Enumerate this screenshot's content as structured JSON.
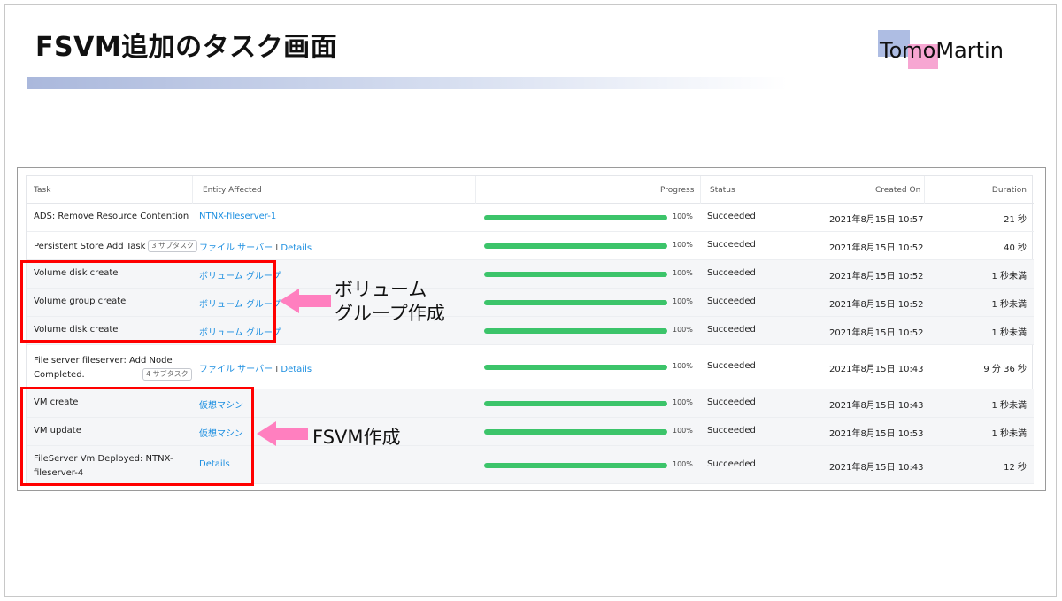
{
  "slide": {
    "title": "FSVM追加のタスク画面",
    "logo_text": "TomoMartin"
  },
  "table": {
    "headers": {
      "task": "Task",
      "entity": "Entity Affected",
      "progress": "Progress",
      "status": "Status",
      "created": "Created On",
      "duration": "Duration"
    },
    "rows": [
      {
        "task": "ADS: Remove Resource Contention",
        "badge": "",
        "entity": "NTNX-fileserver-1",
        "details": "",
        "progress": 1.0,
        "progress_label": "100%",
        "status": "Succeeded",
        "created": "2021年8月15日 10:57",
        "duration": "21 秒"
      },
      {
        "task": "Persistent Store Add Task",
        "badge": "3 サブタスク",
        "entity": "ファイル サーバー",
        "details": "Details",
        "progress": 1.0,
        "progress_label": "100%",
        "status": "Succeeded",
        "created": "2021年8月15日 10:52",
        "duration": "40 秒"
      },
      {
        "task": "Volume disk create",
        "badge": "",
        "entity": "ボリューム グループ",
        "details": "",
        "progress": 1.0,
        "progress_label": "100%",
        "status": "Succeeded",
        "created": "2021年8月15日 10:52",
        "duration": "1 秒未満"
      },
      {
        "task": "Volume group create",
        "badge": "",
        "entity": "ボリューム グループ",
        "details": "",
        "progress": 1.0,
        "progress_label": "100%",
        "status": "Succeeded",
        "created": "2021年8月15日 10:52",
        "duration": "1 秒未満"
      },
      {
        "task": "Volume disk create",
        "badge": "",
        "entity": "ボリューム グループ",
        "details": "",
        "progress": 1.0,
        "progress_label": "100%",
        "status": "Succeeded",
        "created": "2021年8月15日 10:52",
        "duration": "1 秒未満"
      },
      {
        "task": "File server fileserver: Add Node",
        "task_line2": "Completed.",
        "badge": "4 サブタスク",
        "entity": "ファイル サーバー",
        "details": "Details",
        "progress": 1.0,
        "progress_label": "100%",
        "status": "Succeeded",
        "created": "2021年8月15日 10:43",
        "duration": "9 分 36 秒"
      },
      {
        "task": "VM create",
        "badge": "",
        "entity": "仮想マシン",
        "details": "",
        "progress": 1.0,
        "progress_label": "100%",
        "status": "Succeeded",
        "created": "2021年8月15日 10:43",
        "duration": "1 秒未満"
      },
      {
        "task": "VM update",
        "badge": "",
        "entity": "仮想マシン",
        "details": "",
        "progress": 1.0,
        "progress_label": "100%",
        "status": "Succeeded",
        "created": "2021年8月15日 10:53",
        "duration": "1 秒未満"
      },
      {
        "task": "FileServer Vm Deployed: NTNX-",
        "task_line2": "fileserver-4",
        "badge": "",
        "entity": "",
        "details": "Details",
        "progress": 1.0,
        "progress_label": "100%",
        "status": "Succeeded",
        "created": "2021年8月15日 10:43",
        "duration": "12 秒"
      }
    ]
  },
  "annotations": {
    "volume_line1": "ボリューム",
    "volume_line2": "グループ作成",
    "fsvm": "FSVM作成"
  },
  "colors": {
    "highlight": "#ff0000",
    "arrow": "#ff7fbf",
    "progress": "#3cc46a",
    "link": "#1b8ee0"
  }
}
